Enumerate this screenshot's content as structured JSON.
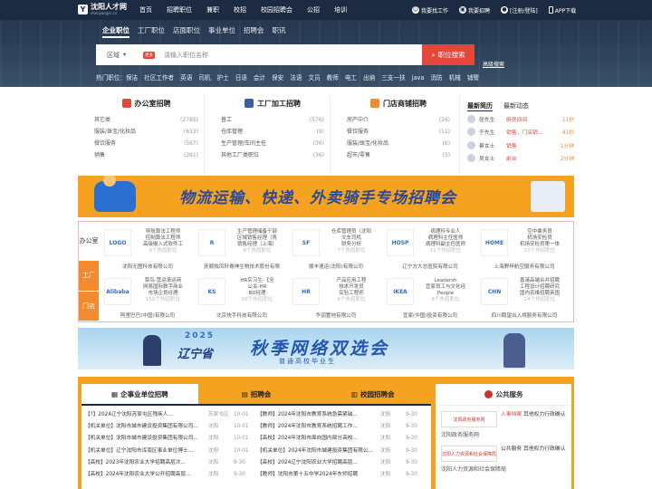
{
  "brand": {
    "name": "沈阳人才网",
    "url_text": "shenyangrc.cn"
  },
  "nav": {
    "links": [
      "首页",
      "招聘职位",
      "兼职",
      "校招",
      "校园招聘会",
      "公招",
      "培训"
    ],
    "right": [
      "我要找工作",
      "我要招聘",
      "[注册/登陆]",
      "APP下载"
    ]
  },
  "search": {
    "tabs": [
      "企业职位",
      "工厂职位",
      "店面职位",
      "事业单位",
      "招聘会",
      "职讯"
    ],
    "area_label": "区域",
    "more_badge": "更多",
    "placeholder": "请输入职位名称",
    "button": "职位搜索",
    "advanced": "高级搜索",
    "hot_label": "热门职位：",
    "hot": [
      "保洁",
      "社区工作者",
      "英语",
      "司机",
      "护士",
      "日语",
      "会计",
      "保安",
      "法语",
      "文员",
      "教师",
      "电工",
      "出纳",
      "三支一扶",
      "java",
      "消防",
      "机械",
      "铺警"
    ]
  },
  "categories": [
    {
      "title": "办公室招聘",
      "color": "#e5473b",
      "items": [
        [
          "其它类",
          "(2785)"
        ],
        [
          "服装/珠宝/化妆品",
          "(633)"
        ],
        [
          "餐饮服务",
          "(567)"
        ],
        [
          "销售",
          "(391)"
        ]
      ]
    },
    {
      "title": "工厂加工招聘",
      "color": "#3b5ea8",
      "items": [
        [
          "普工",
          "(576)"
        ],
        [
          "仓库管理",
          "(9)"
        ],
        [
          "生产管理/车间主任",
          "(36)"
        ],
        [
          "其他工厂类职位",
          "(36)"
        ]
      ]
    },
    {
      "title": "门店商铺招聘",
      "color": "#f28a30",
      "items": [
        [
          "房产中介",
          "(26)"
        ],
        [
          "餐饮服务",
          "(11)"
        ],
        [
          "服装/珠宝/化妆品",
          "(6)"
        ],
        [
          "超市/零售",
          "(5)"
        ]
      ]
    }
  ],
  "latest": {
    "tabs": [
      "最新简历",
      "最新动态"
    ],
    "rows": [
      {
        "name": "张先生",
        "job": "厨房间间",
        "time": "11秒"
      },
      {
        "name": "于先生",
        "job": "销售，门店销...",
        "time": "41秒"
      },
      {
        "name": "蔡女士",
        "job": "销售",
        "time": "1分钟"
      },
      {
        "name": "吴女士",
        "job": "前台",
        "time": "2分钟"
      }
    ]
  },
  "banner_logistics": {
    "text": "物流运输、快递、外卖骑手专场招聘会"
  },
  "companies": {
    "side": [
      "办公室",
      "工厂",
      "门店"
    ],
    "items": [
      {
        "logo": "LOGO",
        "desc": "导航算法工程师\n控制算法工程师\n高级嵌入式软件工",
        "count": "9个热招职位",
        "name": "沈阳无图科技有限公司"
      },
      {
        "logo": "R",
        "desc": "生产管理储备干部\n区域销售经理（青\n销售经理（上海）",
        "count": "8个热招职位",
        "name": "抚顺独凤轩脊神生物技术股份有限"
      },
      {
        "logo": "SF",
        "desc": "仓库管理员（沈阳\n文车司机\n财务分析",
        "count": "7个热招职位",
        "name": "顺丰速运(沈阳)有限公司"
      },
      {
        "logo": "HOSP",
        "desc": "病理科专业人\n病理科主任医师\n病理科副主任医师",
        "count": "11个热招职位",
        "name": "辽宁方大总医院有限公司"
      },
      {
        "logo": "HOME",
        "desc": "空中乘务员\n机场安检员\n机场安检员第一体",
        "count": "10个热招职位",
        "name": "上海野梓航空服务有限公司"
      },
      {
        "logo": "Alibaba",
        "desc": "菜鸟-营运承运商\n网易国际数字商业\n市场企划经理",
        "count": "150个热招职位",
        "name": "阿里巴巴(中国)有限公司"
      },
      {
        "logo": "KS",
        "desc": "HR实习生-【全\n公关-HR\nBD经理",
        "count": "50个热招职位",
        "name": "北京快手科技有限公司"
      },
      {
        "logo": "HR",
        "desc": "产品应用工程\n技术开发员\n实验工程师",
        "count": "6个热招职位",
        "name": "华润置地有限公司"
      },
      {
        "logo": "IKEA",
        "desc": "Leadersh\n宜家员工与文化经\nPeople",
        "count": "8个热招职位",
        "name": "宜家(中国)投资有限公司"
      },
      {
        "logo": "CHN",
        "desc": "香港高端合并招聘\n工程设计招聘研究\n国内农维招聘英国",
        "count": "24个热招职位",
        "name": "四川聘望出入境服务有限公司"
      }
    ]
  },
  "banner_campus": {
    "year": "2025",
    "province": "辽宁省",
    "title": "秋季网络双选会",
    "subtitle": "普通高校毕业生"
  },
  "jobs": {
    "tabs": [
      "企事业单位招聘",
      "招聘会",
      "校园招聘会"
    ],
    "left": [
      {
        "title": "【?】2024辽宁沈阳苏家屯区残疾人...",
        "place": "苏家屯区",
        "date": "10-01"
      },
      {
        "title": "【机关单位】沈阳市城市建设投资集团有限公司...",
        "place": "沈阳",
        "date": "10-01"
      },
      {
        "title": "【机关单位】沈阳市城市建设投资集团有限公司...",
        "place": "沈阳",
        "date": "10-01"
      },
      {
        "title": "【机关单位】辽宁沈阳市浑南区事业单位博士...",
        "place": "沈阳",
        "date": "10-01"
      },
      {
        "title": "【高校】2023年沈阳农业大学招聘高层次...",
        "place": "沈阳",
        "date": "9-30"
      },
      {
        "title": "【高校】2024年沈阳农业大学公开招聘高层...",
        "place": "沈阳",
        "date": "9-30"
      }
    ],
    "right": [
      {
        "title": "【教师】2024年沈阳市教育系统急需紧缺...",
        "place": "沈阳",
        "date": "9-30"
      },
      {
        "title": "【教师】2024年沈阳市教育系统招聘工作...",
        "place": "沈阳",
        "date": "9-30"
      },
      {
        "title": "【高校】2024年沈阳市面向国内部分高校...",
        "place": "沈阳",
        "date": "9-30"
      },
      {
        "title": "【机关单位】2024年沈阳市城建投资集团有限公...",
        "place": "沈阳",
        "date": "9-30"
      },
      {
        "title": "【高校】2024辽宁沈阳农业大学招聘高层...",
        "place": "沈阳",
        "date": "9-30"
      },
      {
        "title": "【教师】沈阳市第十五中学2024年东师招聘",
        "place": "沈阳",
        "date": "9-30"
      }
    ]
  },
  "service": {
    "title": "公共服务",
    "items": [
      {
        "box": "沈阳政务服务网",
        "text_red": "人事档案",
        "text": "其他权力行政确认",
        "caption": "沈阳政务服务网"
      },
      {
        "box": "沈阳人力资源和社会保障局",
        "text_red": "",
        "text": "公共服务 其他权力行政确认",
        "caption": "沈阳人力资源和社会保障局"
      }
    ]
  }
}
